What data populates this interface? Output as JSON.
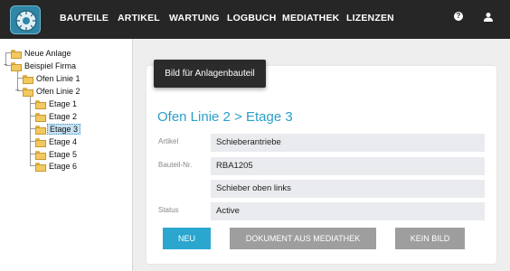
{
  "nav": {
    "items": [
      "BAUTEILE",
      "ARTIKEL",
      "WARTUNG",
      "LOGBUCH",
      "MEDIATHEK",
      "LIZENZEN"
    ],
    "help_icon": "?",
    "user_icon": "user-icon"
  },
  "tree": {
    "nodes": [
      {
        "label": "Neue Anlage",
        "expanded": false
      },
      {
        "label": "Beispiel Firma",
        "expanded": true
      },
      {
        "label": "Ofen Linie 1",
        "expanded": false
      },
      {
        "label": "Ofen Linie 2",
        "expanded": true
      },
      {
        "label": "Etage 1"
      },
      {
        "label": "Etage 2"
      },
      {
        "label": "Etage 3",
        "selected": true
      },
      {
        "label": "Etage 4"
      },
      {
        "label": "Etage 5"
      },
      {
        "label": "Etage 6"
      }
    ]
  },
  "tooltip": "Bild für Anlagenbauteil",
  "detail": {
    "title": "Ofen Linie 2 > Etage 3",
    "fields": [
      {
        "label": "Artikel",
        "value": "Schieberantriebe"
      },
      {
        "label": "Bauteil-Nr.",
        "value": "RBA1205"
      },
      {
        "label": "",
        "value": "Schieber oben links"
      },
      {
        "label": "Status",
        "value": "Active"
      }
    ]
  },
  "buttons": {
    "new": "NEU",
    "doc_from_library": "DOKUMENT AUS MEDIATHEK",
    "no_image": "KEIN BILD"
  },
  "colors": {
    "accent": "#2aa6cf",
    "topbar": "#262626",
    "button_gray": "#9e9e9e"
  }
}
